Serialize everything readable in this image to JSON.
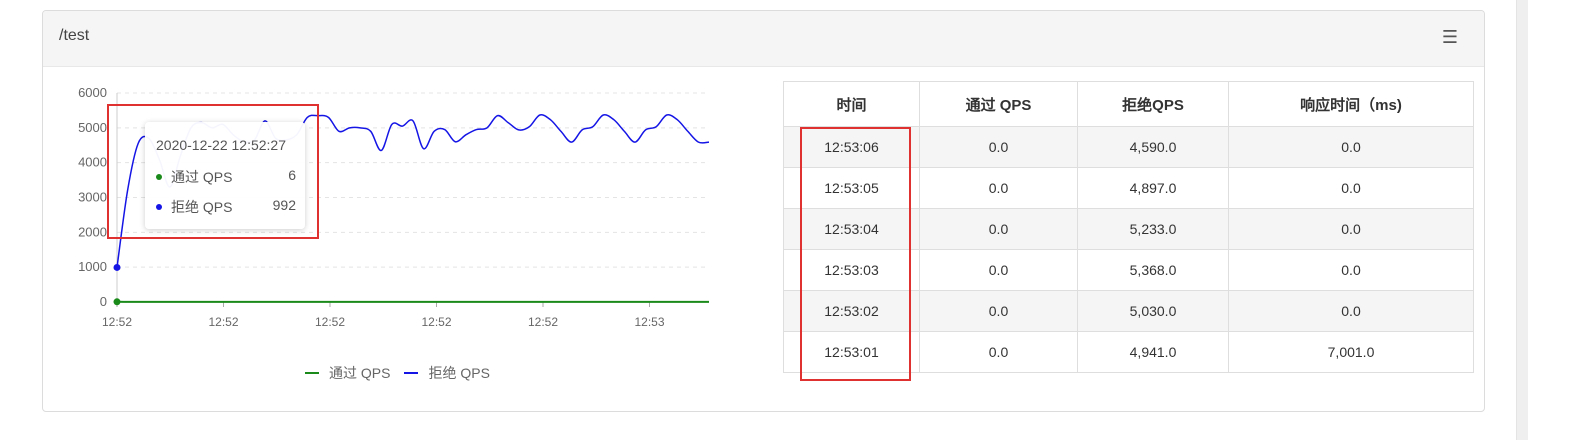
{
  "panel": {
    "title": "/test"
  },
  "colors": {
    "pass": "#1a8a1a",
    "reject": "#1515e6",
    "highlight": "#e03131"
  },
  "tooltip": {
    "time": "2020-12-22 12:52:27",
    "rows": [
      {
        "label": "通过 QPS",
        "value": "6",
        "color": "#1a8a1a"
      },
      {
        "label": "拒绝 QPS",
        "value": "992",
        "color": "#1515e6"
      }
    ]
  },
  "legend": [
    {
      "label": "通过 QPS",
      "color": "#1a8a1a"
    },
    {
      "label": "拒绝 QPS",
      "color": "#1515e6"
    }
  ],
  "chart_data": {
    "type": "line",
    "ylim": [
      0,
      6000
    ],
    "yticks": [
      "6000",
      "5000",
      "4000",
      "3000",
      "2000",
      "1000",
      "0"
    ],
    "xticks": [
      "12:52",
      "12:52",
      "12:52",
      "12:52",
      "12:52",
      "12:53"
    ],
    "grid": true,
    "legend_position": "bottom",
    "series": [
      {
        "name": "通过 QPS",
        "x": [
          0,
          1,
          2,
          3,
          4,
          5,
          6,
          7,
          8,
          9,
          10,
          11,
          12,
          13,
          14,
          15,
          16,
          17,
          18,
          19,
          20,
          21,
          22,
          23,
          24,
          25,
          26,
          27,
          28,
          29,
          30,
          31,
          32,
          33,
          34,
          35,
          36,
          37,
          38,
          39,
          40,
          41,
          42,
          43,
          44,
          45,
          46,
          47,
          48,
          49,
          50,
          51,
          52,
          53,
          54,
          55,
          56
        ],
        "values": [
          6,
          5,
          5,
          5,
          5,
          5,
          5,
          5,
          5,
          5,
          5,
          5,
          5,
          5,
          5,
          5,
          5,
          5,
          5,
          5,
          5,
          5,
          5,
          5,
          5,
          5,
          5,
          5,
          5,
          5,
          5,
          5,
          5,
          5,
          5,
          5,
          5,
          5,
          5,
          5,
          5,
          5,
          5,
          5,
          5,
          5,
          5,
          5,
          5,
          5,
          5,
          5,
          5,
          5,
          5,
          5,
          5
        ]
      },
      {
        "name": "拒绝 QPS",
        "x": [
          0,
          1,
          2,
          3,
          4,
          5,
          6,
          7,
          8,
          9,
          10,
          11,
          12,
          13,
          14,
          15,
          16,
          17,
          18,
          19,
          20,
          21,
          22,
          23,
          24,
          25,
          26,
          27,
          28,
          29,
          30,
          31,
          32,
          33,
          34,
          35,
          36,
          37,
          38,
          39,
          40,
          41,
          42,
          43,
          44,
          45,
          46,
          47,
          48,
          49,
          50,
          51,
          52,
          53,
          54,
          55,
          56
        ],
        "values": [
          992,
          3200,
          4550,
          4700,
          4100,
          3300,
          4200,
          5000,
          5150,
          5000,
          5100,
          4800,
          4600,
          4650,
          5200,
          4700,
          4650,
          4800,
          5300,
          5350,
          5300,
          4900,
          5000,
          5000,
          4900,
          4350,
          5100,
          5050,
          5200,
          4400,
          4900,
          4950,
          4600,
          4800,
          4950,
          5000,
          5350,
          5150,
          4941,
          5030,
          5368,
          5233,
          4897,
          4590,
          4941,
          5030,
          5368,
          5233,
          4897,
          4590,
          4941,
          5030,
          5368,
          5233,
          4897,
          4590,
          4590
        ]
      }
    ]
  },
  "table": {
    "headers": [
      "时间",
      "通过 QPS",
      "拒绝QPS",
      "响应时间（ms)"
    ],
    "rows": [
      [
        "12:53:06",
        "0.0",
        "4,590.0",
        "0.0"
      ],
      [
        "12:53:05",
        "0.0",
        "4,897.0",
        "0.0"
      ],
      [
        "12:53:04",
        "0.0",
        "5,233.0",
        "0.0"
      ],
      [
        "12:53:03",
        "0.0",
        "5,368.0",
        "0.0"
      ],
      [
        "12:53:02",
        "0.0",
        "5,030.0",
        "0.0"
      ],
      [
        "12:53:01",
        "0.0",
        "4,941.0",
        "7,001.0"
      ]
    ]
  },
  "icons": {
    "corner": "list-icon"
  }
}
